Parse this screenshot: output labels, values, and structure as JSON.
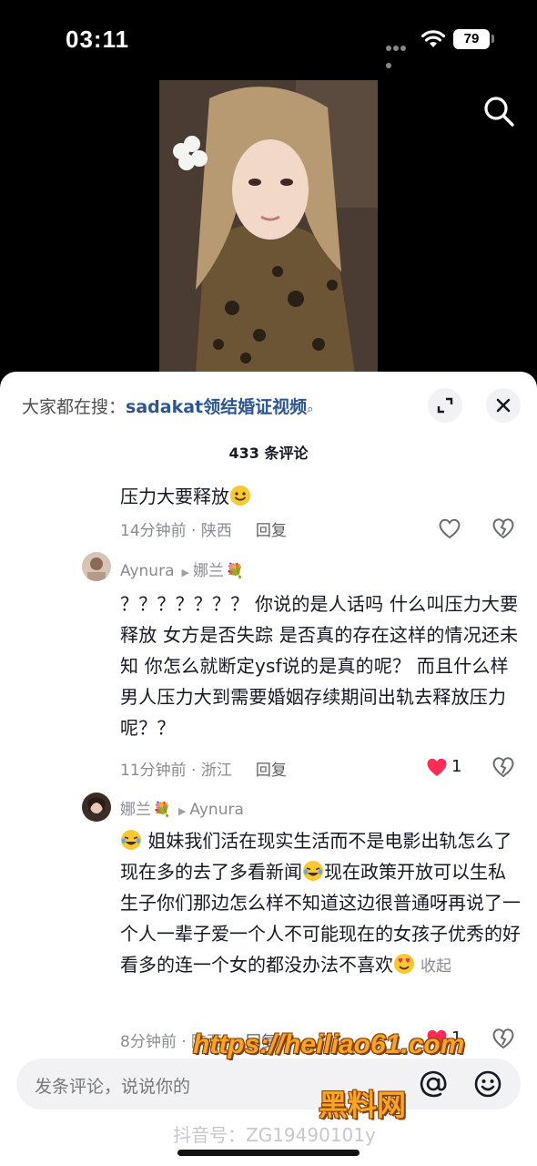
{
  "status_bar": {
    "time": "03:11",
    "battery": "79"
  },
  "sheet": {
    "hot_search_prefix": "大家都在搜：",
    "hot_search_keyword": "sadakat领结婚证视频",
    "comment_count": "433 条评论"
  },
  "comments": [
    {
      "text": "压力大要释放",
      "emoji": "smile-emoji",
      "time": "14分钟前 · 陕西",
      "reply": "回复"
    },
    {
      "author": "Aynura",
      "reply_to": "娜兰",
      "text": "？？？？？？？ 你说的是人话吗  什么叫压力大要释放  女方是否失踪  是否真的存在这样的情况还未知  你怎么就断定ysf说的是真的呢？  而且什么样男人压力大到需要婚姻存续期间出轨去释放压力呢？？",
      "time": "11分钟前 · 浙江",
      "reply": "回复",
      "likes": "1"
    },
    {
      "author": "娜兰",
      "reply_to": "Aynura",
      "text_a": " 姐妹我们活在现实生活而不是电影出轨怎么了现在多的去了多看新闻",
      "text_b": "现在政策开放可以生私生子你们那边怎么样不知道这边很普通呀再说了一个人一辈子爱一个人不可能现在的女孩子优秀的好看多的连一个女的都没办法不喜欢",
      "collapse": "收起",
      "time": "8分钟前 · 陕西",
      "reply": "回复",
      "likes": "1"
    }
  ],
  "input": {
    "placeholder": "发条评论，说说你的"
  },
  "watermark": {
    "url": "https://heiliao61.com",
    "brand": "黑料网"
  },
  "douyin_id": "抖音号：ZG19490101y",
  "colors": {
    "accent": "#2c5593",
    "like": "#fe2c55",
    "watermark": "#f5a623"
  }
}
